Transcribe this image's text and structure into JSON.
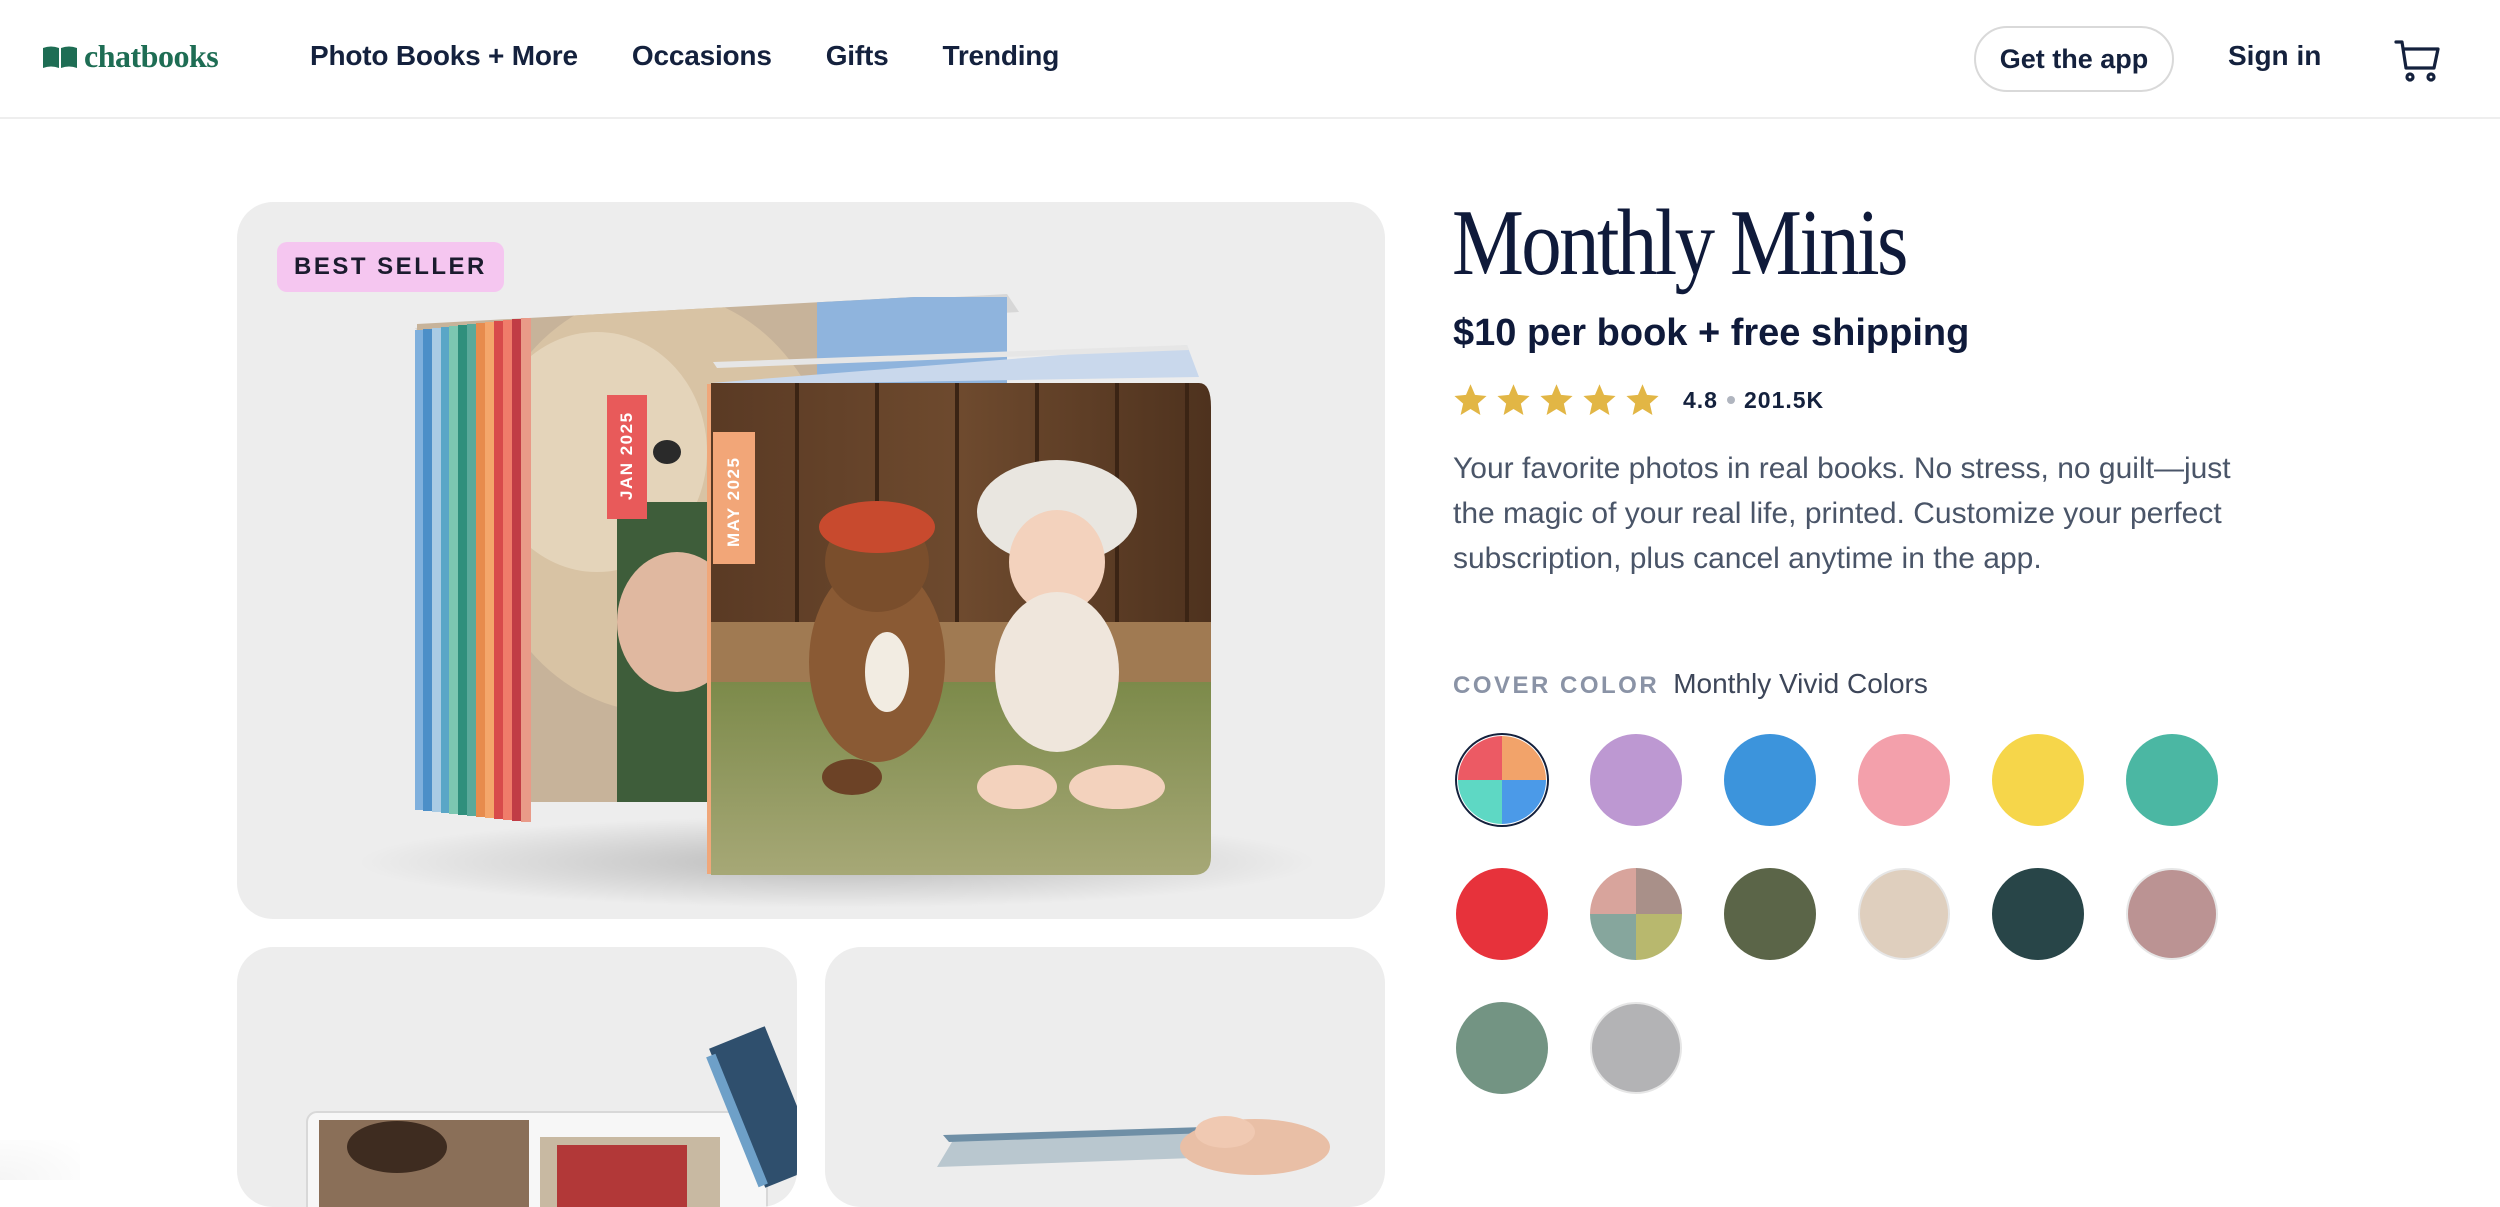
{
  "header": {
    "logo_text": "chatbooks",
    "nav": [
      {
        "label": "Photo Books + More"
      },
      {
        "label": "Occasions"
      },
      {
        "label": "Gifts"
      },
      {
        "label": "Trending"
      }
    ],
    "get_app_label": "Get the app",
    "sign_in_label": "Sign in",
    "cart_icon": "cart-icon"
  },
  "gallery": {
    "badge": "BEST SELLER",
    "spine_labels": [
      "JAN 2025",
      "MAY 2025"
    ]
  },
  "product": {
    "title": "Monthly Minis",
    "price": "$10 per book + free shipping",
    "rating": {
      "value": "4.8",
      "count": "201.5K",
      "stars": 5
    },
    "description": "Your favorite photos in real books. No stress, no guilt—just the magic of your real life, printed. Customize your perfect subscription, plus cancel anytime in the app.",
    "cover_color_label": "COVER COLOR",
    "cover_color_value": "Monthly Vivid Colors",
    "swatches": [
      {
        "name": "monthly-vivid-colors",
        "colors": [
          "#ec5a64",
          "#f2a36a",
          "#5ed8c4",
          "#4b9ae8"
        ],
        "selected": true
      },
      {
        "name": "lavender",
        "colors": [
          "#bd98d2"
        ]
      },
      {
        "name": "blue",
        "colors": [
          "#3c94dc"
        ]
      },
      {
        "name": "pink",
        "colors": [
          "#f3a0ab"
        ]
      },
      {
        "name": "yellow",
        "colors": [
          "#f6d64a"
        ]
      },
      {
        "name": "teal",
        "colors": [
          "#4bb7a3"
        ]
      },
      {
        "name": "red",
        "colors": [
          "#e7323b"
        ]
      },
      {
        "name": "muted-mix",
        "colors": [
          "#d8a49c",
          "#a99089",
          "#86a69d",
          "#b8b86e"
        ]
      },
      {
        "name": "olive",
        "colors": [
          "#5b6548"
        ]
      },
      {
        "name": "sand",
        "colors": [
          "#dfcfbe"
        ]
      },
      {
        "name": "dark-teal",
        "colors": [
          "#284548"
        ]
      },
      {
        "name": "mauve",
        "colors": [
          "#bb9393"
        ]
      },
      {
        "name": "sage",
        "colors": [
          "#739483"
        ]
      },
      {
        "name": "gray",
        "colors": [
          "#b3b3b5"
        ]
      }
    ]
  },
  "colors": {
    "brand": "#1e6d54",
    "text": "#14213d",
    "star": "#e2b645",
    "badge": "#f5c6f0"
  }
}
